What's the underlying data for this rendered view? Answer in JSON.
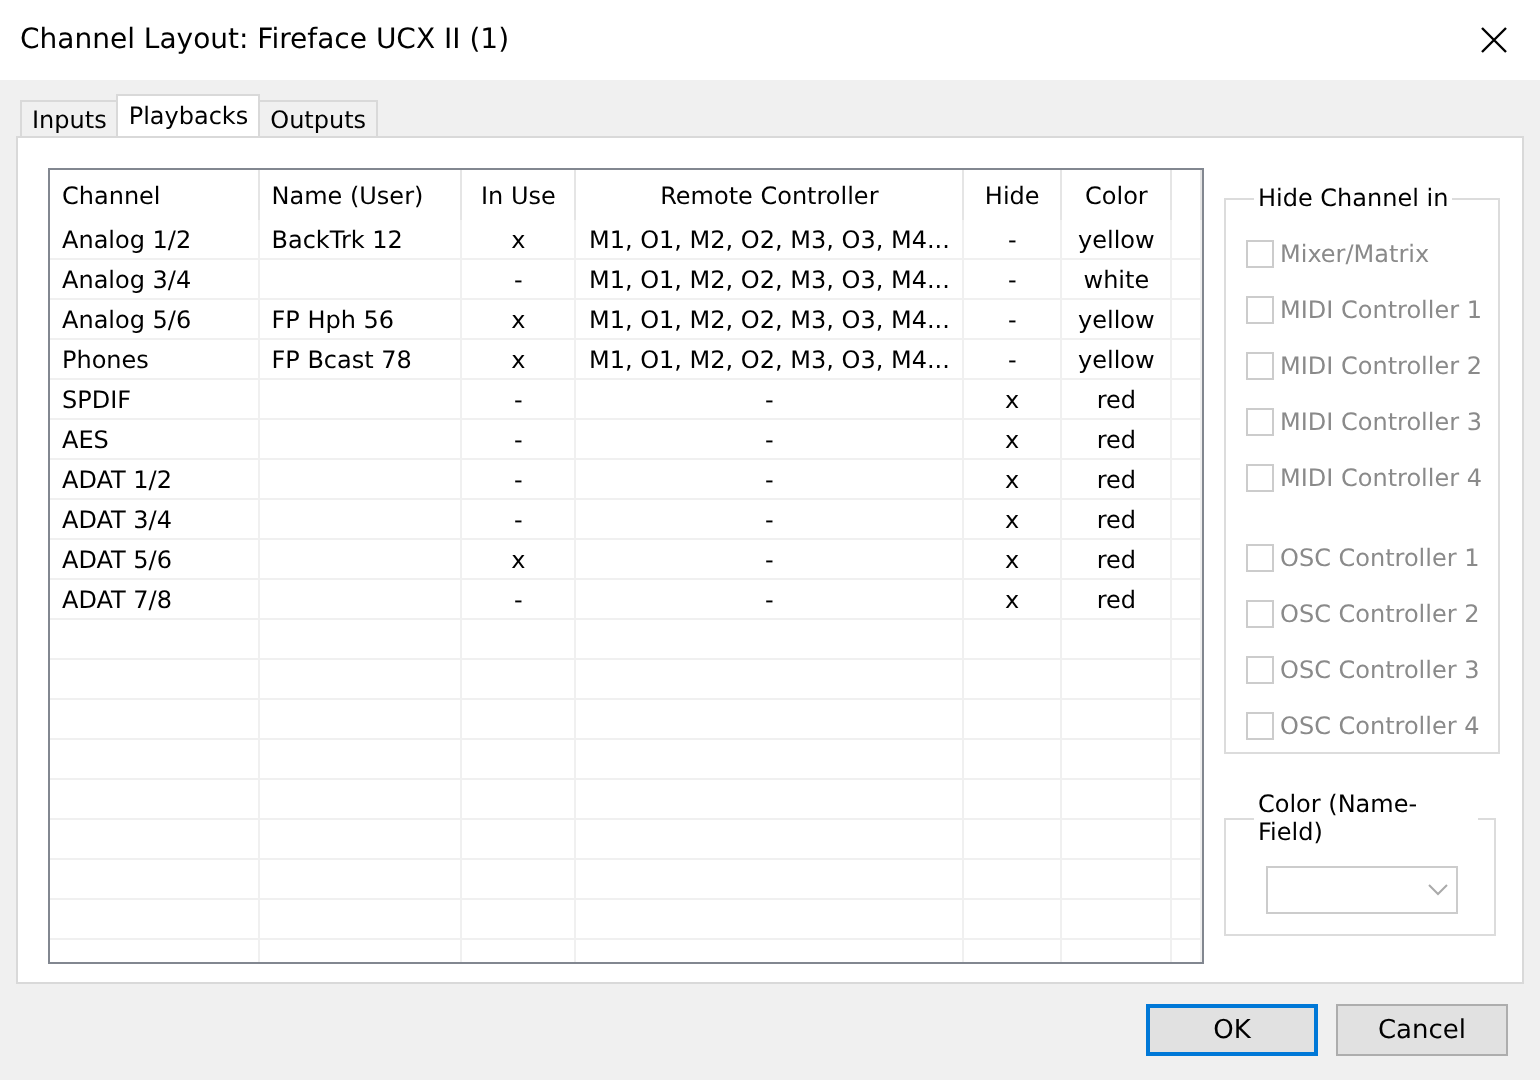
{
  "window": {
    "title": "Channel Layout: Fireface UCX II (1)"
  },
  "tabs": [
    {
      "label": "Inputs",
      "selected": false
    },
    {
      "label": "Playbacks",
      "selected": true
    },
    {
      "label": "Outputs",
      "selected": false
    }
  ],
  "table": {
    "columns": [
      "Channel",
      "Name (User)",
      "In Use",
      "Remote Controller",
      "Hide",
      "Color"
    ],
    "rows": [
      [
        "Analog 1/2",
        "BackTrk 12",
        "x",
        "M1, O1, M2, O2, M3, O3, M4...",
        "-",
        "yellow"
      ],
      [
        "Analog 3/4",
        "",
        "-",
        "M1, O1, M2, O2, M3, O3, M4...",
        "-",
        "white"
      ],
      [
        "Analog 5/6",
        "FP Hph 56",
        "x",
        "M1, O1, M2, O2, M3, O3, M4...",
        "-",
        "yellow"
      ],
      [
        "Phones",
        "FP Bcast 78",
        "x",
        "M1, O1, M2, O2, M3, O3, M4...",
        "-",
        "yellow"
      ],
      [
        "SPDIF",
        "",
        "-",
        "-",
        "x",
        "red"
      ],
      [
        "AES",
        "",
        "-",
        "-",
        "x",
        "red"
      ],
      [
        "ADAT 1/2",
        "",
        "-",
        "-",
        "x",
        "red"
      ],
      [
        "ADAT 3/4",
        "",
        "-",
        "-",
        "x",
        "red"
      ],
      [
        "ADAT 5/6",
        "",
        "x",
        "-",
        "x",
        "red"
      ],
      [
        "ADAT 7/8",
        "",
        "-",
        "-",
        "x",
        "red"
      ]
    ]
  },
  "hide_channel_in": {
    "title": "Hide Channel in",
    "groups": [
      {
        "items": [
          {
            "label": "Mixer/Matrix",
            "checked": false,
            "disabled": true
          },
          {
            "label": "MIDI Controller 1",
            "checked": false,
            "disabled": true
          },
          {
            "label": "MIDI Controller 2",
            "checked": false,
            "disabled": true
          },
          {
            "label": "MIDI Controller 3",
            "checked": false,
            "disabled": true
          },
          {
            "label": "MIDI Controller 4",
            "checked": false,
            "disabled": true
          }
        ]
      },
      {
        "items": [
          {
            "label": "OSC Controller 1",
            "checked": false,
            "disabled": true
          },
          {
            "label": "OSC Controller 2",
            "checked": false,
            "disabled": true
          },
          {
            "label": "OSC Controller 3",
            "checked": false,
            "disabled": true
          },
          {
            "label": "OSC Controller 4",
            "checked": false,
            "disabled": true
          }
        ]
      }
    ]
  },
  "color_name_field": {
    "title": "Color (Name-Field)",
    "dropdown": {
      "disabled": true
    }
  },
  "buttons": [
    {
      "label": "OK",
      "default": true
    },
    {
      "label": "Cancel",
      "default": false
    }
  ]
}
